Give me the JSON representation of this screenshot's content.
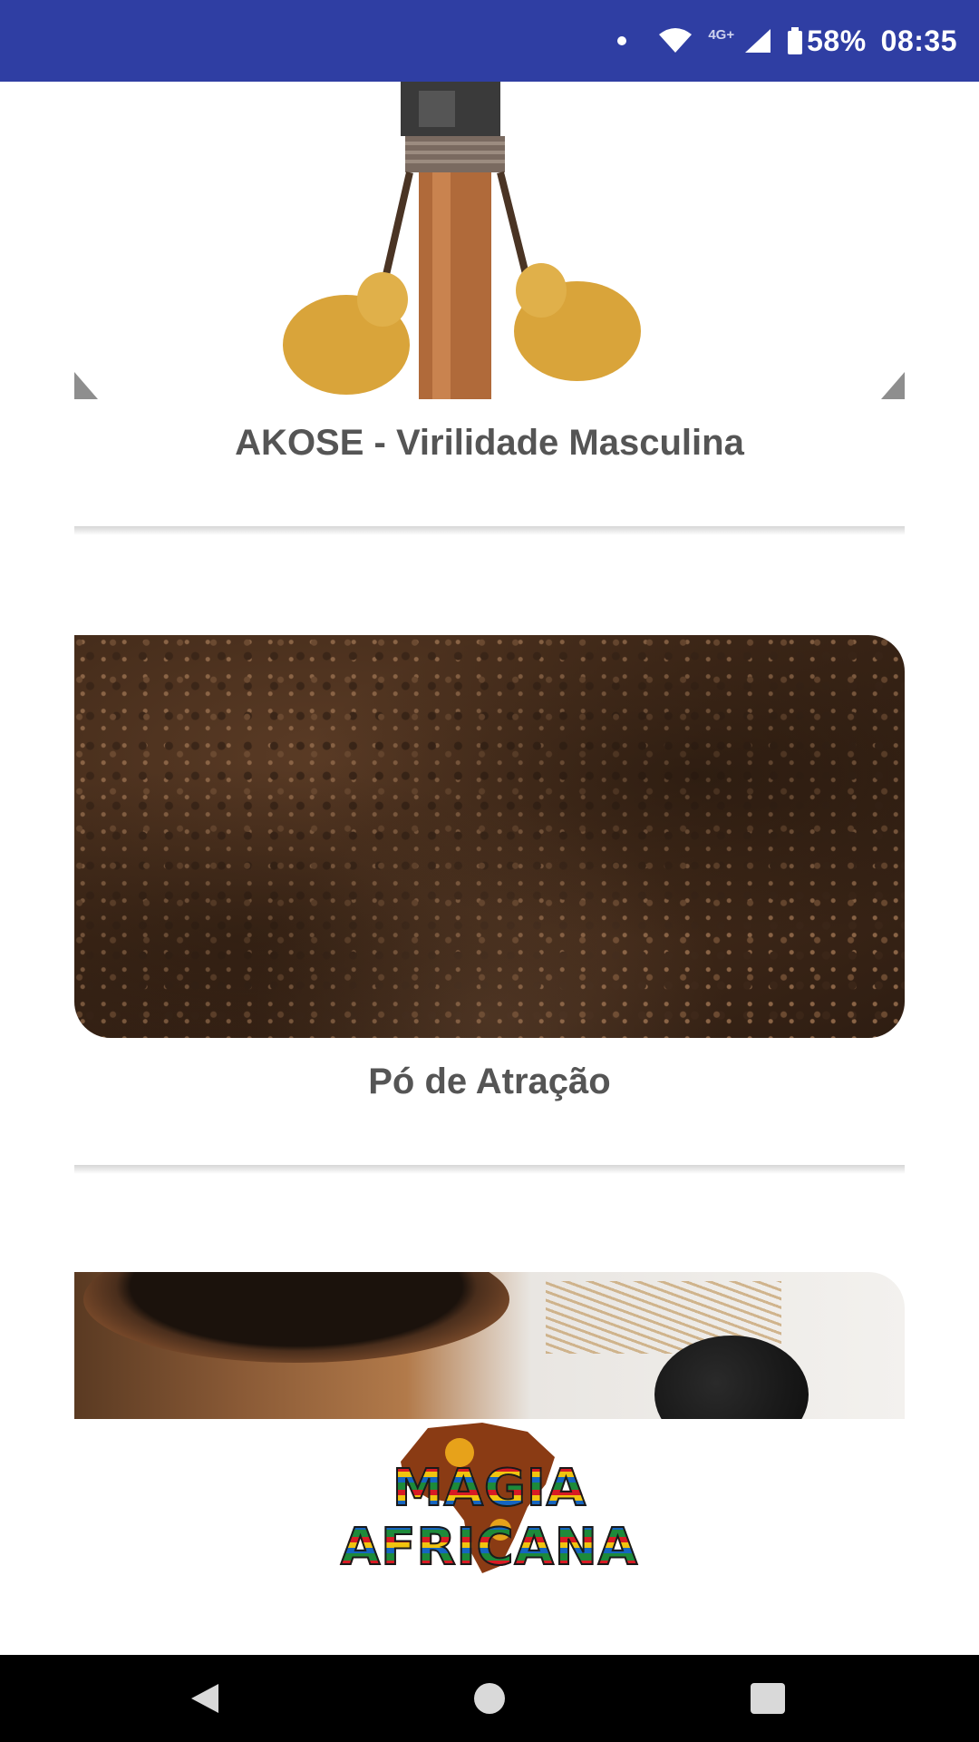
{
  "status_bar": {
    "network": "4G+",
    "battery": "58%",
    "time": "08:35",
    "icons": [
      "notification-dot-icon",
      "wifi-icon",
      "signal-icon",
      "battery-icon"
    ],
    "background_color": "#2f3ea3"
  },
  "cards": [
    {
      "title": "AKOSE - Virilidade Masculina",
      "image_icon": "akose-product-image"
    },
    {
      "title": "Pó de Atração",
      "image_icon": "attraction-powder-image"
    },
    {
      "title": "",
      "image_icon": "jar-product-image"
    }
  ],
  "logo": {
    "text": "MAGIA AFRICANA"
  },
  "nav_bar": {
    "icons": [
      "back-icon",
      "home-icon",
      "recents-icon"
    ]
  }
}
